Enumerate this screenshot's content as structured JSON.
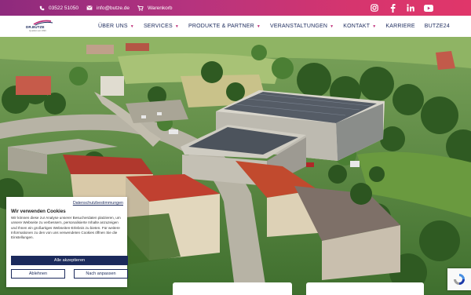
{
  "topbar": {
    "phone": "03522 51050",
    "email": "info@butze.de",
    "cart": "Warenkorb",
    "social": [
      "instagram-icon",
      "facebook-icon",
      "linkedin-icon",
      "youtube-icon"
    ]
  },
  "logo": {
    "name": "DR.BUTZE",
    "tagline": "Qualität seit 1990"
  },
  "nav": {
    "items": [
      {
        "label": "ÜBER UNS",
        "dropdown": true
      },
      {
        "label": "SERVICES",
        "dropdown": true
      },
      {
        "label": "PRODUKTE & PARTNER",
        "dropdown": true
      },
      {
        "label": "VERANSTALTUNGEN",
        "dropdown": true
      },
      {
        "label": "KONTAKT",
        "dropdown": true
      },
      {
        "label": "KARRIERE",
        "dropdown": false
      },
      {
        "label": "BUTZE24",
        "dropdown": false
      }
    ]
  },
  "cookie": {
    "privacy_link": "Datenschutzbestimmungen",
    "title": "Wir verwenden Cookies",
    "text": "Wir können diese zur Analyse unserer Besucherdaten platzieren, um unsere Webseite zu verbessern, personalisierte Inhalte anzuzeigen und Ihnen ein großartiges Webseiten-Erlebnis zu bieten. Für weitere Informationen zu den von uns verwendeten Cookies öffnen Sie die Einstellungen.",
    "accept_all": "Alle akzeptieren",
    "reject": "Ablehnen",
    "customize": "Nach anpassen"
  },
  "colors": {
    "brand": "#1b2a5c",
    "accent": "#c0307a",
    "gradient_start": "#8e2a7d",
    "gradient_end": "#e0366a"
  }
}
